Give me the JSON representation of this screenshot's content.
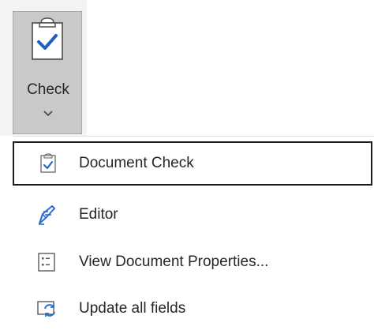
{
  "ribbon": {
    "check_button": {
      "label": "Check",
      "icon": "clipboard-check-icon",
      "dropdown_icon": "chevron-down-icon"
    }
  },
  "menu": {
    "items": [
      {
        "label": "Document Check",
        "icon": "clipboard-check-icon",
        "focused": true
      },
      {
        "label": "Editor",
        "icon": "editor-pen-icon",
        "focused": false
      },
      {
        "label": "View Document Properties...",
        "icon": "document-properties-icon",
        "focused": false,
        "access_key": "i"
      },
      {
        "label": "Update all fields",
        "icon": "update-fields-icon",
        "focused": false
      }
    ]
  },
  "colors": {
    "accent_blue": "#2b579a",
    "check_blue": "#1f5fbf",
    "pressed_button": "#c9c9c9",
    "focus_border": "#1b1b1b"
  }
}
